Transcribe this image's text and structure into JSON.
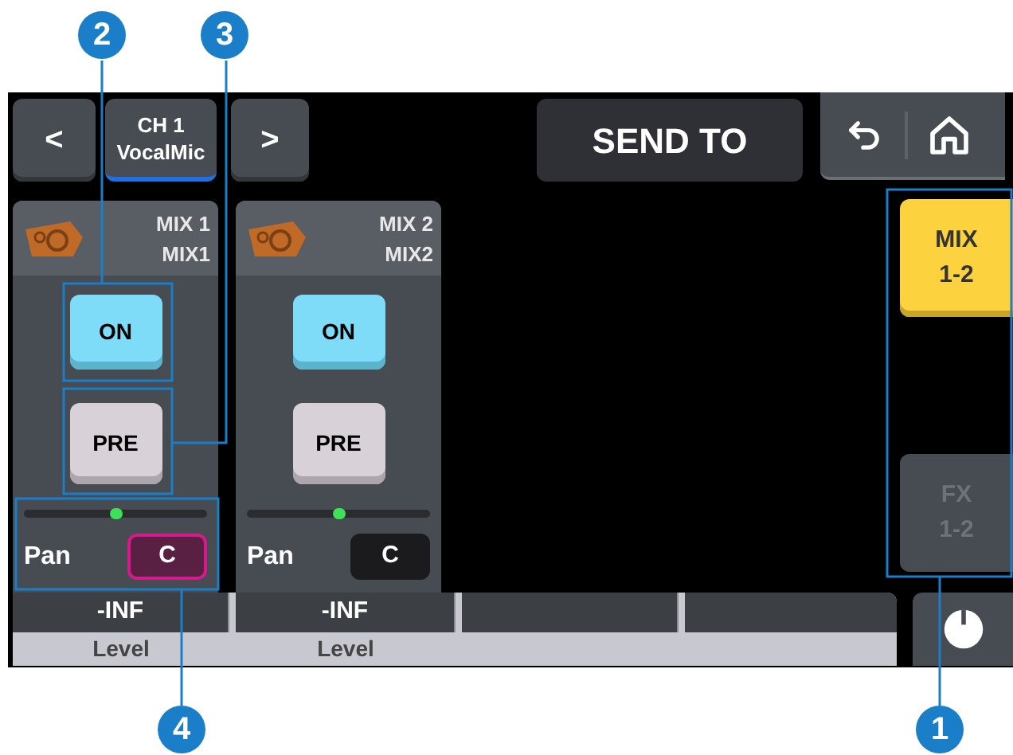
{
  "nav": {
    "prev": "<",
    "channel_number": "CH 1",
    "channel_name": "VocalMic",
    "next": ">"
  },
  "title": "SEND TO",
  "sends": [
    {
      "bus": "MIX 1",
      "name": "MIX1",
      "on_label": "ON",
      "on": true,
      "pre_label": "PRE",
      "pre": true,
      "pan": {
        "label": "Pan",
        "level": 0.5,
        "value": "C",
        "selected": true
      },
      "level_value": "-INF",
      "level_label": "Level"
    },
    {
      "bus": "MIX 2",
      "name": "MIX2",
      "on_label": "ON",
      "on": true,
      "pre_label": "PRE",
      "pre": true,
      "pan": {
        "label": "Pan",
        "level": 0.5,
        "value": "C",
        "selected": false
      },
      "level_value": "-INF",
      "level_label": "Level"
    }
  ],
  "bus_tabs": [
    {
      "lines": [
        "MIX",
        "1-2"
      ],
      "selected": true
    },
    {
      "lines": [
        "FX",
        "1-2"
      ],
      "selected": false
    }
  ],
  "callouts": [
    {
      "number": "2"
    },
    {
      "number": "3"
    },
    {
      "number": "4"
    },
    {
      "number": "1"
    }
  ]
}
